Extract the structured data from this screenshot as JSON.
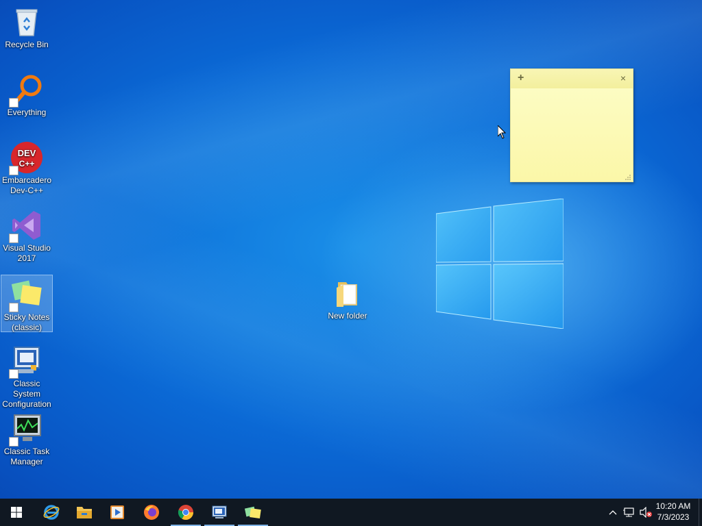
{
  "desktop": {
    "icons": [
      {
        "label": "Recycle Bin"
      },
      {
        "label": "Everything"
      },
      {
        "label": "Embarcadero Dev-C++"
      },
      {
        "label": "Visual Studio 2017"
      },
      {
        "label": "Sticky Notes (classic)"
      },
      {
        "label": "Classic System Configuration"
      },
      {
        "label": "Classic Task Manager"
      },
      {
        "label": "New folder"
      }
    ],
    "devcpp_icon_text": "DEV C++"
  },
  "sticky_note": {
    "add_glyph": "+",
    "close_glyph": "×",
    "text": ""
  },
  "taskbar": {
    "apps": [
      "start-icon",
      "internet-explorer-icon",
      "file-explorer-icon",
      "media-player-icon",
      "firefox-icon",
      "chrome-icon",
      "system-configuration-icon",
      "sticky-notes-icon"
    ],
    "active_apps": [
      "chrome-icon",
      "system-configuration-icon",
      "sticky-notes-icon"
    ],
    "tray": {
      "chevron": "^",
      "clock_time": "10:20 AM",
      "clock_date": "7/3/2023"
    }
  },
  "colors": {
    "accent": "#0b6ad6",
    "sticky": "#fcf8b0",
    "taskbar": "#101822"
  }
}
